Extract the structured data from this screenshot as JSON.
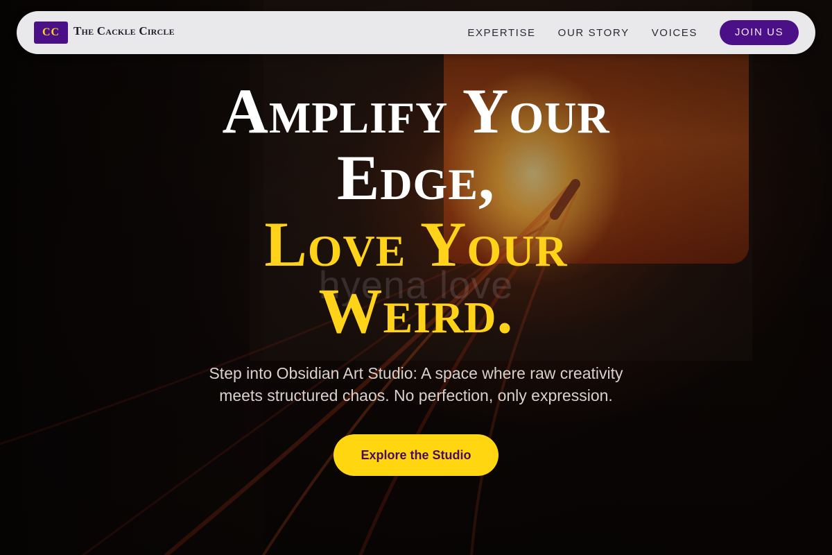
{
  "brand": {
    "badge_text": "CC",
    "name": "The Cackle Circle",
    "badge_color": "#4b0f87",
    "badge_text_color": "#ffd31a"
  },
  "nav": {
    "links": [
      {
        "label": "EXPERTISE"
      },
      {
        "label": "OUR STORY"
      },
      {
        "label": "VOICES"
      }
    ],
    "cta_label": "JOIN US"
  },
  "hero": {
    "headline_lines": [
      "Amplify Your",
      "Edge,",
      "Love Your",
      "Weird."
    ],
    "subtext_line1": "Step into Obsidian Art Studio: A space where raw creativity",
    "subtext_line2": "meets structured chaos. No perfection, only expression.",
    "cta_label": "Explore the Studio",
    "watermark": "hyena love"
  },
  "colors": {
    "accent_yellow": "#ffd31a",
    "accent_purple": "#4b0f87",
    "nav_background": "#e9e8ea"
  },
  "background": {
    "icon": "forge-fire-image"
  }
}
